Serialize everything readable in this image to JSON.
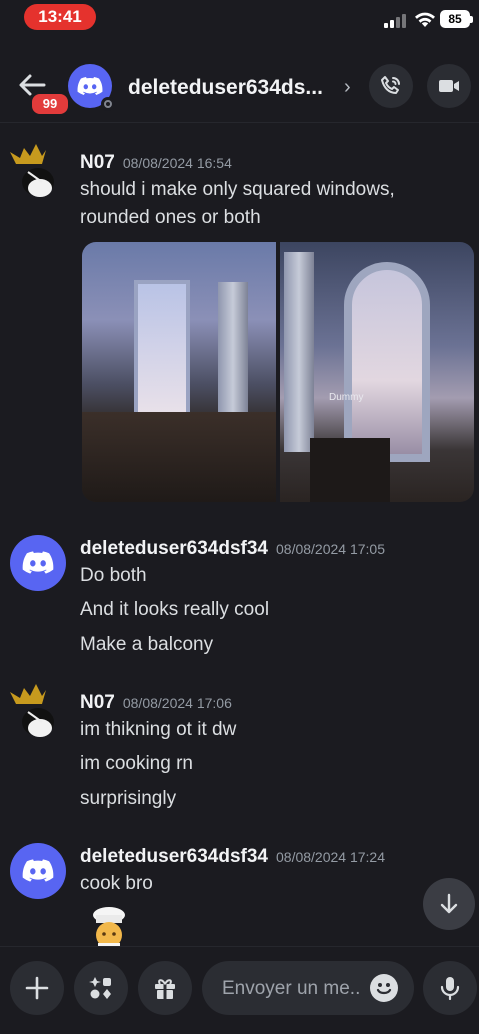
{
  "status_bar": {
    "time": "13:41",
    "battery": "85"
  },
  "header": {
    "unread_badge": "99",
    "title": "deleteduser634ds...",
    "chevron": "›"
  },
  "messages": [
    {
      "author": "N07",
      "timestamp": "08/08/2024 16:54",
      "lines": [
        "should i make only squared windows,",
        "rounded ones or both"
      ],
      "attachments": [
        "Dummy"
      ]
    },
    {
      "author": "deleteduser634dsf34",
      "timestamp": "08/08/2024 17:05",
      "lines": [
        "Do both",
        "And it looks really cool",
        "Make a balcony"
      ]
    },
    {
      "author": "N07",
      "timestamp": "08/08/2024 17:06",
      "lines": [
        "im thikning ot it dw",
        "im cooking rn",
        "surprisingly"
      ]
    },
    {
      "author": "deleteduser634dsf34",
      "timestamp": "08/08/2024 17:24",
      "lines": [
        "cook bro"
      ]
    }
  ],
  "composer": {
    "placeholder": "Envoyer un me.."
  },
  "icons": [
    "back-arrow-icon",
    "phone-call-icon",
    "video-camera-icon",
    "plus-icon",
    "apps-icon",
    "gift-icon",
    "emoji-icon",
    "microphone-icon",
    "arrow-down-icon",
    "discord-logo-icon"
  ],
  "colors": {
    "accent": "#5865f2",
    "badge": "#e23b3b",
    "background": "#1b1b20"
  }
}
